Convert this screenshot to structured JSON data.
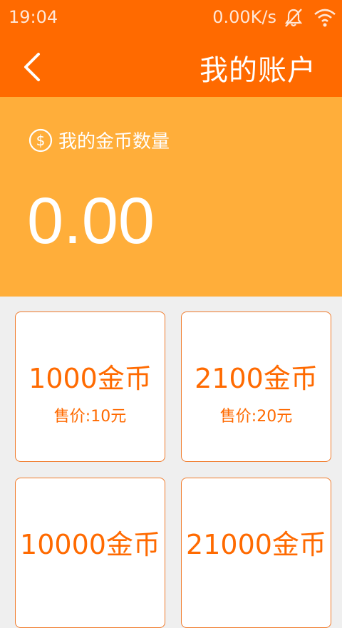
{
  "status_bar": {
    "time": "19:04",
    "network_speed": "0.00K/s",
    "icons": [
      "mute-icon",
      "wifi-icon"
    ]
  },
  "header": {
    "title": "我的账户",
    "back_icon": "chevron-left-icon"
  },
  "balance": {
    "label": "我的金币数量",
    "icon": "dollar-coin-icon",
    "amount": "0.00"
  },
  "packages": [
    {
      "coins": "1000金币",
      "price": "售价:10元"
    },
    {
      "coins": "2100金币",
      "price": "售价:20元"
    },
    {
      "coins": "10000金币",
      "price": ""
    },
    {
      "coins": "21000金币",
      "price": ""
    }
  ],
  "colors": {
    "header_bg": "#ff6a00",
    "balance_bg": "#ffae3a",
    "accent": "#ff6a00",
    "page_bg": "#efefef"
  }
}
